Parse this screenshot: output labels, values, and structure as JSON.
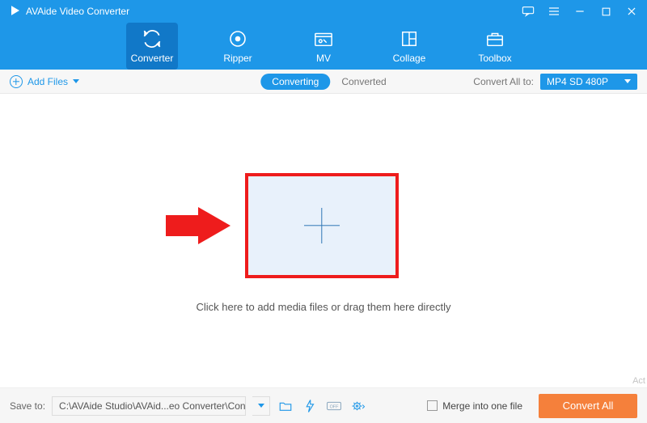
{
  "app_title": "AVAide Video Converter",
  "tabs": {
    "converter": "Converter",
    "ripper": "Ripper",
    "mv": "MV",
    "collage": "Collage",
    "toolbox": "Toolbox"
  },
  "subbar": {
    "add_files": "Add Files",
    "mode_converting": "Converting",
    "mode_converted": "Converted",
    "convert_all_to_label": "Convert All to:",
    "convert_all_to_value": "MP4 SD 480P"
  },
  "main": {
    "drop_text": "Click here to add media files or drag them here directly",
    "watermark_fragment": "Act"
  },
  "footer": {
    "save_to_label": "Save to:",
    "save_path": "C:\\AVAide Studio\\AVAid...eo Converter\\Converted",
    "merge_label": "Merge into one file",
    "convert_button": "Convert All"
  }
}
